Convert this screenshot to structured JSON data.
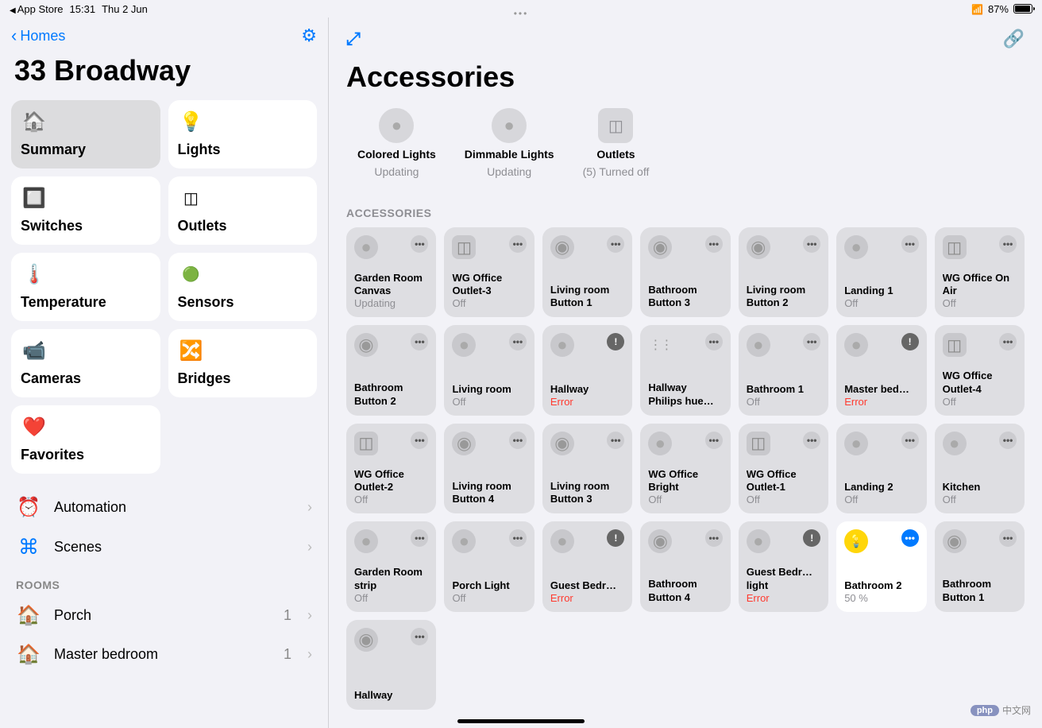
{
  "statusbar": {
    "back_app": "App Store",
    "time": "15:31",
    "date": "Thu 2 Jun",
    "battery_pct": "87%"
  },
  "sidebar": {
    "back_label": "Homes",
    "home_name": "33 Broadway",
    "tiles": [
      {
        "label": "Summary",
        "icon": "house",
        "selected": true
      },
      {
        "label": "Lights",
        "icon": "bulb",
        "selected": false
      },
      {
        "label": "Switches",
        "icon": "switch",
        "selected": false
      },
      {
        "label": "Outlets",
        "icon": "outlet",
        "selected": false
      },
      {
        "label": "Temperature",
        "icon": "temp",
        "selected": false
      },
      {
        "label": "Sensors",
        "icon": "sensor",
        "selected": false
      },
      {
        "label": "Cameras",
        "icon": "camera",
        "selected": false
      },
      {
        "label": "Bridges",
        "icon": "bridge",
        "selected": false
      },
      {
        "label": "Favorites",
        "icon": "heart",
        "selected": false
      }
    ],
    "list": [
      {
        "label": "Automation",
        "icon": "clock"
      },
      {
        "label": "Scenes",
        "icon": "cmd"
      }
    ],
    "rooms_header": "ROOMS",
    "rooms": [
      {
        "label": "Porch",
        "count": "1"
      },
      {
        "label": "Master bedroom",
        "count": "1"
      }
    ]
  },
  "main": {
    "title": "Accessories",
    "status": [
      {
        "label": "Colored Lights",
        "sub": "Updating",
        "icon": "bulb"
      },
      {
        "label": "Dimmable Lights",
        "sub": "Updating",
        "icon": "bulb"
      },
      {
        "label": "Outlets",
        "sub": "(5) Turned off",
        "icon": "outlet"
      }
    ],
    "section_title": "ACCESSORIES",
    "accessories": [
      {
        "name": "Garden Room Canvas",
        "state": "Updating",
        "icon": "bulb",
        "more": "dots"
      },
      {
        "name": "WG Office Outlet-3",
        "state": "Off",
        "icon": "outlet",
        "more": "dots"
      },
      {
        "name": "Living room Button 1",
        "state": "",
        "icon": "button",
        "more": "dots"
      },
      {
        "name": "Bathroom Button 3",
        "state": "",
        "icon": "button",
        "more": "dots"
      },
      {
        "name": "Living room Button 2",
        "state": "",
        "icon": "button",
        "more": "dots"
      },
      {
        "name": "Landing 1",
        "state": "Off",
        "icon": "bulb",
        "more": "dots"
      },
      {
        "name": "WG Office On Air",
        "state": "Off",
        "icon": "outlet",
        "more": "dots"
      },
      {
        "name": "Bathroom Button 2",
        "state": "",
        "icon": "button",
        "more": "dots"
      },
      {
        "name": "Living room",
        "state": "Off",
        "icon": "bulb",
        "more": "dots"
      },
      {
        "name": "Hallway",
        "state": "Error",
        "icon": "bulb",
        "more": "alert",
        "error": true
      },
      {
        "name": "Hallway Philips hue…",
        "state": "",
        "icon": "hue",
        "more": "dots"
      },
      {
        "name": "Bathroom 1",
        "state": "Off",
        "icon": "bulb",
        "more": "dots"
      },
      {
        "name": "Master bed…",
        "state": "Error",
        "icon": "bulb",
        "more": "alert",
        "error": true
      },
      {
        "name": "WG Office Outlet-4",
        "state": "Off",
        "icon": "outlet",
        "more": "dots"
      },
      {
        "name": "WG Office Outlet-2",
        "state": "Off",
        "icon": "outlet",
        "more": "dots"
      },
      {
        "name": "Living room Button 4",
        "state": "",
        "icon": "button",
        "more": "dots"
      },
      {
        "name": "Living room Button 3",
        "state": "",
        "icon": "button",
        "more": "dots"
      },
      {
        "name": "WG Office Bright",
        "state": "Off",
        "icon": "bulb",
        "more": "dots"
      },
      {
        "name": "WG Office Outlet-1",
        "state": "Off",
        "icon": "outlet",
        "more": "dots"
      },
      {
        "name": "Landing 2",
        "state": "Off",
        "icon": "bulb",
        "more": "dots"
      },
      {
        "name": "Kitchen",
        "state": "Off",
        "icon": "bulb",
        "more": "dots"
      },
      {
        "name": "Garden Room strip",
        "state": "Off",
        "icon": "bulb",
        "more": "dots"
      },
      {
        "name": "Porch Light",
        "state": "Off",
        "icon": "bulb",
        "more": "dots"
      },
      {
        "name": "Guest Bedr…",
        "state": "Error",
        "icon": "bulb",
        "more": "alert",
        "error": true
      },
      {
        "name": "Bathroom Button 4",
        "state": "",
        "icon": "button",
        "more": "dots"
      },
      {
        "name": "Guest Bedr… light",
        "state": "Error",
        "icon": "bulb",
        "more": "alert",
        "error": true
      },
      {
        "name": "Bathroom 2",
        "state": "50 %",
        "icon": "bulb-on",
        "more": "blue",
        "on": true
      },
      {
        "name": "Bathroom Button 1",
        "state": "",
        "icon": "button",
        "more": "dots"
      },
      {
        "name": "Hallway",
        "state": "",
        "icon": "button",
        "more": "dots"
      }
    ]
  },
  "watermark": {
    "brand": "php",
    "text": "中文网"
  }
}
